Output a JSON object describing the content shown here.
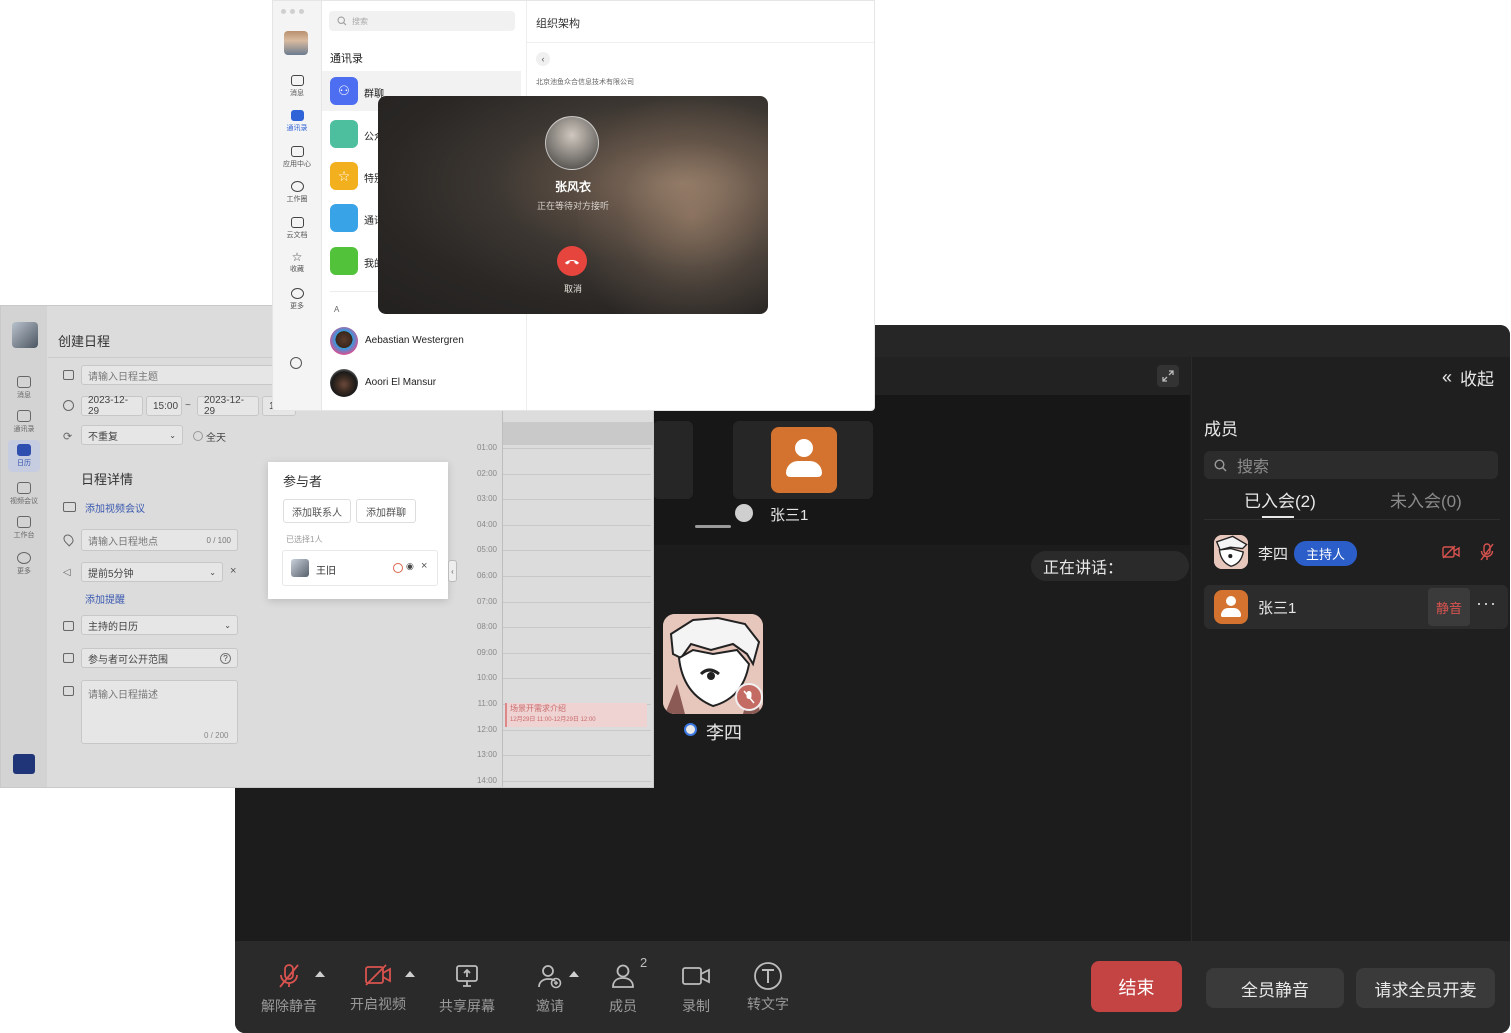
{
  "contacts_window": {
    "search_placeholder": "搜索",
    "panel_title": "组织架构",
    "list_title": "通讯录",
    "company_name": "北京池鱼众合信息技术有限公司",
    "groups": [
      {
        "label": "群聊",
        "color": "#4d6ef0"
      },
      {
        "label": "公众号",
        "color": "#4dbf9f"
      },
      {
        "label": "特别关注",
        "color": "#f2b01e"
      },
      {
        "label": "通讯录",
        "color": "#39a3e8"
      },
      {
        "label": "我的部门",
        "color": "#52c23a"
      }
    ],
    "section_letter": "A",
    "people": [
      {
        "name": "Aebastian Westergren"
      },
      {
        "name": "Aoori El Mansur"
      }
    ],
    "nav": [
      {
        "label": "消息",
        "icon": "chat-icon"
      },
      {
        "label": "通讯录",
        "icon": "contacts-icon",
        "active": true
      },
      {
        "label": "应用中心",
        "icon": "apps-icon"
      },
      {
        "label": "工作圈",
        "icon": "compass-icon"
      },
      {
        "label": "云文档",
        "icon": "cloud-doc-icon"
      },
      {
        "label": "收藏",
        "icon": "star-icon"
      },
      {
        "label": "更多",
        "icon": "more-icon"
      }
    ]
  },
  "call": {
    "caller_name": "张风衣",
    "status": "正在等待对方接听",
    "cancel_label": "取消"
  },
  "calendar_window": {
    "title": "创建日程",
    "title_placeholder": "请输入日程主题",
    "start_date": "2023-12-29",
    "start_time": "15:00",
    "range_sep": "~",
    "end_date": "2023-12-29",
    "end_time": "1",
    "repeat": "不重复",
    "all_day": "全天",
    "details_heading": "日程详情",
    "add_video_meeting": "添加视频会议",
    "location_placeholder": "请输入日程地点",
    "location_count": "0 / 100",
    "reminder": "提前5分钟",
    "add_reminder": "添加提醒",
    "calendar_select": "主持的日历",
    "visibility": "参与者可公开范围",
    "desc_placeholder": "请输入日程描述",
    "desc_count": "0 / 200",
    "hours": [
      "01:00",
      "02:00",
      "03:00",
      "04:00",
      "05:00",
      "06:00",
      "07:00",
      "08:00",
      "09:00",
      "10:00",
      "11:00",
      "12:00",
      "13:00",
      "14:00"
    ],
    "event_title": "场景开需求介绍",
    "event_time": "12月29日 11:00-12月29日 12:00",
    "nav": [
      {
        "label": "消息",
        "icon": "chat-icon"
      },
      {
        "label": "通讯录",
        "icon": "contacts-icon"
      },
      {
        "label": "日历",
        "icon": "calendar-icon",
        "active": true
      },
      {
        "label": "视频会议",
        "icon": "video-icon"
      },
      {
        "label": "工作台",
        "icon": "apps-icon"
      },
      {
        "label": "更多",
        "icon": "more-icon"
      }
    ]
  },
  "participants": {
    "title": "参与者",
    "add_contact": "添加联系人",
    "add_group": "添加群聊",
    "selected_count": "已选择1人",
    "person": "王旧"
  },
  "meeting": {
    "tile_name": "张三1",
    "speaking_label": "正在讲话：",
    "speaker_name": "李四",
    "collapse_label": "收起",
    "members_title": "成员",
    "search_placeholder": "搜索",
    "tab_joined": "已入会(2)",
    "tab_not_joined": "未入会(0)",
    "members": [
      {
        "name": "李四",
        "badge": "主持人"
      },
      {
        "name": "张三1",
        "action": "静音"
      }
    ],
    "toolbar": [
      {
        "label": "解除静音",
        "icon": "mic-off-icon",
        "alert": true
      },
      {
        "label": "开启视频",
        "icon": "video-off-icon",
        "alert": true
      },
      {
        "label": "共享屏幕",
        "icon": "share-screen-icon"
      },
      {
        "label": "邀请",
        "icon": "invite-icon"
      },
      {
        "label": "成员",
        "icon": "members-icon",
        "count": "2"
      },
      {
        "label": "录制",
        "icon": "record-icon"
      },
      {
        "label": "转文字",
        "icon": "transcribe-icon"
      }
    ],
    "end_label": "结束",
    "mute_all_label": "全员静音",
    "unmute_all_label": "请求全员开麦",
    "colors": {
      "alert": "#d9534f",
      "host_badge": "#2b5ec8",
      "avatar_orange": "#d4722f",
      "end_button": "#c44343"
    }
  }
}
